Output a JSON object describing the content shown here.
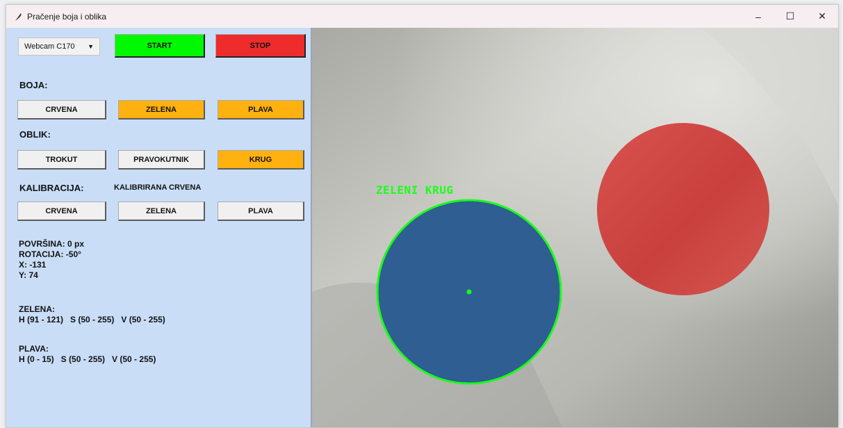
{
  "window": {
    "title": "Pračenje boja i oblika",
    "controls": {
      "minimize": "–",
      "maximize": "☐",
      "close": "✕"
    }
  },
  "camera": {
    "selected": "Webcam C170"
  },
  "actions": {
    "start": "START",
    "stop": "STOP"
  },
  "color_section": {
    "heading": "BOJA:",
    "buttons": [
      "CRVENA",
      "ZELENA",
      "PLAVA"
    ],
    "selected": "ZELENA"
  },
  "shape_section": {
    "heading": "OBLIK:",
    "buttons": [
      "TROKUT",
      "PRAVOKUTNIK",
      "KRUG"
    ],
    "selected": "KRUG"
  },
  "calibration_section": {
    "heading": "KALIBRACIJA:",
    "status": "KALIBRIRANA CRVENA",
    "buttons": [
      "CRVENA",
      "ZELENA",
      "PLAVA"
    ]
  },
  "stats": {
    "area": "POVRŠINA: 0 px",
    "rotation": "ROTACIJA: -50°",
    "x": "X: -131",
    "y": "Y: 74"
  },
  "ranges": {
    "green_title": "ZELENA:",
    "green_values": "H (91 - 121)   S (50 - 255)   V (50 - 255)",
    "blue_title": "PLAVA:",
    "blue_values": "H (0 - 15)   S (50 - 255)   V (50 - 255)"
  },
  "detection": {
    "label": "ZELENI KRUG"
  },
  "colors": {
    "panel_bg": "#c9ddf7",
    "start_green": "#00f800",
    "stop_red": "#ee2c2c",
    "selected_orange": "#ffb10f",
    "detection_green": "#19ff19",
    "blue_object": "#2f5e92",
    "red_object": "#d44a45"
  }
}
